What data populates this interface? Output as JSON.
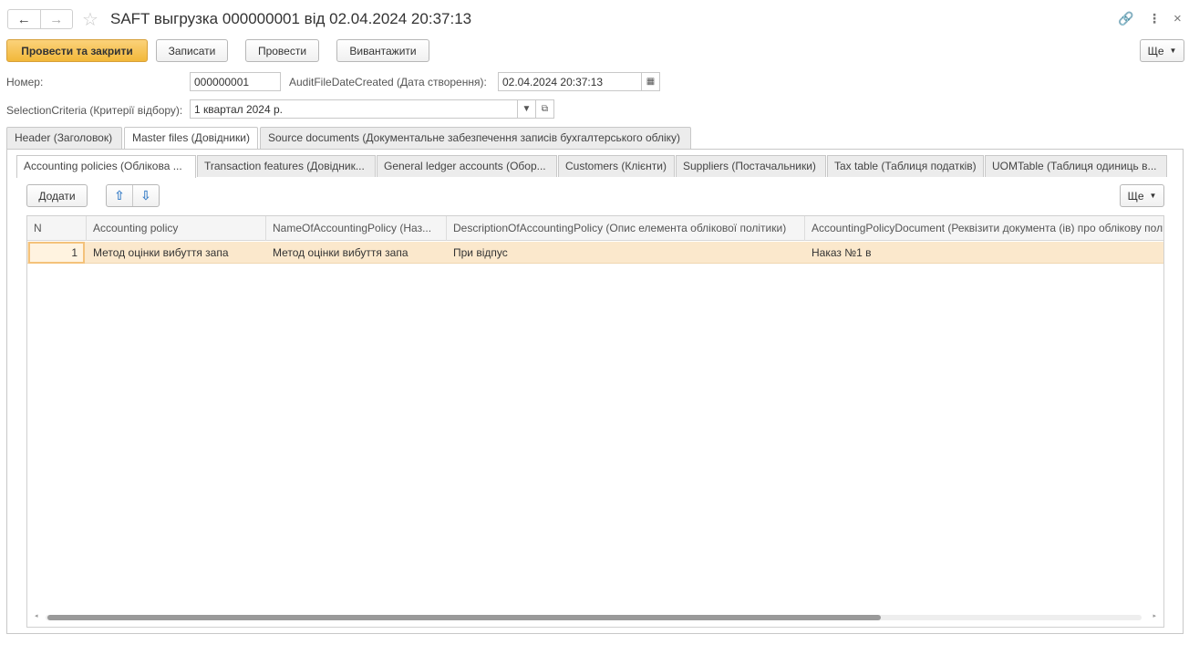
{
  "window": {
    "title": "SAFT выгрузка 000000001 від 02.04.2024 20:37:13",
    "back_glyph": "←",
    "forward_glyph": "→",
    "star_glyph": "☆",
    "link_glyph": "🔗",
    "menu_glyph": "⋮",
    "close_glyph": "×"
  },
  "toolbar": {
    "post_and_close": "Провести та закрити",
    "save": "Записати",
    "post": "Провести",
    "export": "Вивантажити",
    "more": "Ще"
  },
  "form": {
    "number_label": "Номер:",
    "number_value": "000000001",
    "date_label": "AuditFileDateCreated (Дата створення):",
    "date_value": "02.04.2024 20:37:13",
    "criteria_label": "SelectionCriteria (Критерії відбору):",
    "criteria_value": "1 квартал 2024 р."
  },
  "tabs": [
    {
      "label": "Header (Заголовок)"
    },
    {
      "label": "Master files (Довідники)"
    },
    {
      "label": "Source documents (Документальне забезпечення записів бухгалтерського обліку)"
    }
  ],
  "inner_tabs": [
    {
      "label": "Accounting policies (Облікова ..."
    },
    {
      "label": "Transaction features (Довідник..."
    },
    {
      "label": "General ledger accounts (Обор..."
    },
    {
      "label": "Customers (Клієнти)"
    },
    {
      "label": "Suppliers (Постачальники)"
    },
    {
      "label": "Tax table (Таблиця податків)"
    },
    {
      "label": "UOMTable (Таблиця одиниць в..."
    }
  ],
  "table_toolbar": {
    "add": "Додати",
    "more": "Ще",
    "up_glyph": "⇧",
    "down_glyph": "⇩"
  },
  "table": {
    "columns": [
      "N",
      "Accounting policy",
      "NameOfAccountingPolicy (Наз...",
      "DescriptionOfAccountingPolicy (Опис елемента облікової політики)",
      "AccountingPolicyDocument (Реквізити документа (ів) про облікову пол"
    ],
    "rows": [
      [
        "1",
        "Метод оцінки вибуття запа",
        "Метод оцінки вибуття запа",
        "При відпус",
        "Наказ №1 в"
      ]
    ]
  },
  "colors": {
    "primary_button": "#f2b83a",
    "selected_row": "#fbe8cc",
    "arrow_blue": "#3b7fc7"
  }
}
